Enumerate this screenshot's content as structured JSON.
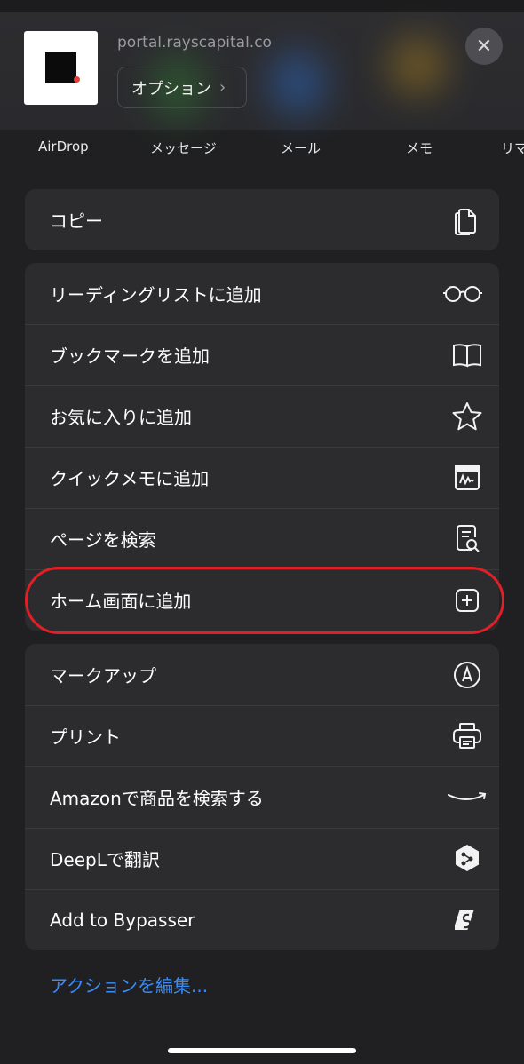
{
  "header": {
    "url": "portal.rayscapital.co",
    "options_label": "オプション",
    "options_chevron": "›",
    "close_glyph": "✕"
  },
  "apps": [
    "AirDrop",
    "メッセージ",
    "メール",
    "メモ",
    "リマ"
  ],
  "actions": {
    "group1": [
      {
        "label": "コピー",
        "icon": "copy-icon"
      }
    ],
    "group2": [
      {
        "label": "リーディングリストに追加",
        "icon": "glasses-icon"
      },
      {
        "label": "ブックマークを追加",
        "icon": "book-icon"
      },
      {
        "label": "お気に入りに追加",
        "icon": "star-icon"
      },
      {
        "label": "クイックメモに追加",
        "icon": "quick-note-icon"
      },
      {
        "label": "ページを検索",
        "icon": "find-page-icon"
      },
      {
        "label": "ホーム画面に追加",
        "icon": "add-square-icon"
      }
    ],
    "group3": [
      {
        "label": "マークアップ",
        "icon": "markup-icon"
      },
      {
        "label": "プリント",
        "icon": "printer-icon"
      },
      {
        "label": "Amazonで商品を検索する",
        "icon": "amazon-smile-icon"
      },
      {
        "label": "DeepLで翻訳",
        "icon": "deepl-icon"
      },
      {
        "label": "Add to Bypasser",
        "icon": "bypasser-icon"
      }
    ]
  },
  "edit_actions_label": "アクションを編集...",
  "colors": {
    "highlight": "#e01f26",
    "link": "#3c8cf5",
    "row_bg": "#2c2c2e",
    "sheet_bg": "#202022"
  }
}
